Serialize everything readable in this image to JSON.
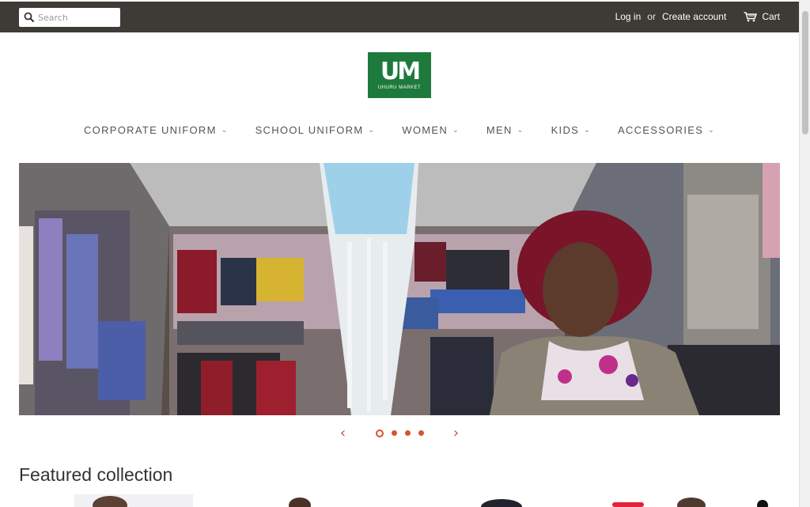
{
  "search": {
    "placeholder": "Search"
  },
  "account": {
    "login": "Log in",
    "or": "or",
    "create": "Create account",
    "cart": "Cart"
  },
  "brand": {
    "mark": "UM",
    "name": "UHURU MARKET",
    "color": "#1e7a3c"
  },
  "nav": [
    {
      "label": "CORPORATE UNIFORM"
    },
    {
      "label": "SCHOOL UNIFORM"
    },
    {
      "label": "WOMEN"
    },
    {
      "label": "MEN"
    },
    {
      "label": "KIDS"
    },
    {
      "label": "ACCESSORIES"
    }
  ],
  "slider": {
    "prev": "‹",
    "next": "›",
    "slides": 4,
    "active": 1
  },
  "featured": {
    "title": "Featured collection"
  },
  "colors": {
    "topbar": "#3e3a35",
    "accent": "#d9532f"
  }
}
